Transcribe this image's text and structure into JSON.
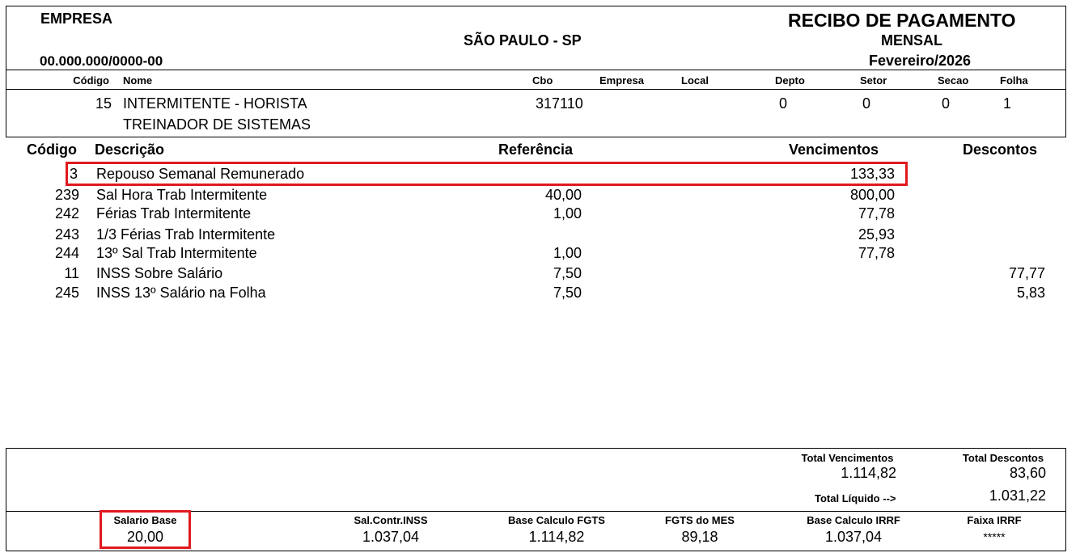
{
  "header": {
    "empresa_label": "EMPRESA",
    "cnpj": "00.000.000/0000-00",
    "city": "SÃO PAULO - SP",
    "title": "RECIBO DE PAGAMENTO",
    "type": "MENSAL",
    "period": "Fevereiro/2026"
  },
  "employee_header": {
    "codigo": "Código",
    "nome": "Nome",
    "cbo": "Cbo",
    "empresa": "Empresa",
    "local": "Local",
    "depto": "Depto",
    "setor": "Setor",
    "secao": "Secao",
    "folha": "Folha"
  },
  "employee": {
    "codigo": "15",
    "nome": "INTERMITENTE - HORISTA",
    "cargo": "TREINADOR DE SISTEMAS",
    "cbo": "317110",
    "depto": "0",
    "setor": "0",
    "secao": "0",
    "folha": "1"
  },
  "items_header": {
    "codigo": "Código",
    "descricao": "Descrição",
    "referencia": "Referência",
    "vencimentos": "Vencimentos",
    "descontos": "Descontos"
  },
  "items": [
    {
      "codigo": "3",
      "descricao": "Repouso Semanal Remunerado",
      "referencia": "",
      "vencimentos": "133,33",
      "descontos": ""
    },
    {
      "codigo": "239",
      "descricao": "Sal Hora Trab Intermitente",
      "referencia": "40,00",
      "vencimentos": "800,00",
      "descontos": ""
    },
    {
      "codigo": "242",
      "descricao": "Férias Trab Intermitente",
      "referencia": "1,00",
      "vencimentos": "77,78",
      "descontos": ""
    },
    {
      "codigo": "243",
      "descricao": "1/3 Férias Trab Intermitente",
      "referencia": "",
      "vencimentos": "25,93",
      "descontos": ""
    },
    {
      "codigo": "244",
      "descricao": "13º Sal Trab Intermitente",
      "referencia": "1,00",
      "vencimentos": "77,78",
      "descontos": ""
    },
    {
      "codigo": "11",
      "descricao": "INSS Sobre Salário",
      "referencia": "7,50",
      "vencimentos": "",
      "descontos": "77,77"
    },
    {
      "codigo": "245",
      "descricao": "INSS 13º Salário na Folha",
      "referencia": "7,50",
      "vencimentos": "",
      "descontos": "5,83"
    }
  ],
  "totals": {
    "total_vencimentos_label": "Total Vencimentos",
    "total_vencimentos": "1.114,82",
    "total_descontos_label": "Total Descontos",
    "total_descontos": "83,60",
    "total_liquido_label": "Total Líquido -->",
    "total_liquido": "1.031,22"
  },
  "bases": {
    "salario_base_label": "Salario Base",
    "salario_base": "20,00",
    "sal_contr_inss_label": "Sal.Contr.INSS",
    "sal_contr_inss": "1.037,04",
    "base_fgts_label": "Base Calculo FGTS",
    "base_fgts": "1.114,82",
    "fgts_mes_label": "FGTS do MES",
    "fgts_mes": "89,18",
    "base_irrf_label": "Base Calculo IRRF",
    "base_irrf": "1.037,04",
    "faixa_irrf_label": "Faixa IRRF",
    "faixa_irrf": "*****"
  },
  "colors": {
    "highlight": "#e0191f"
  }
}
